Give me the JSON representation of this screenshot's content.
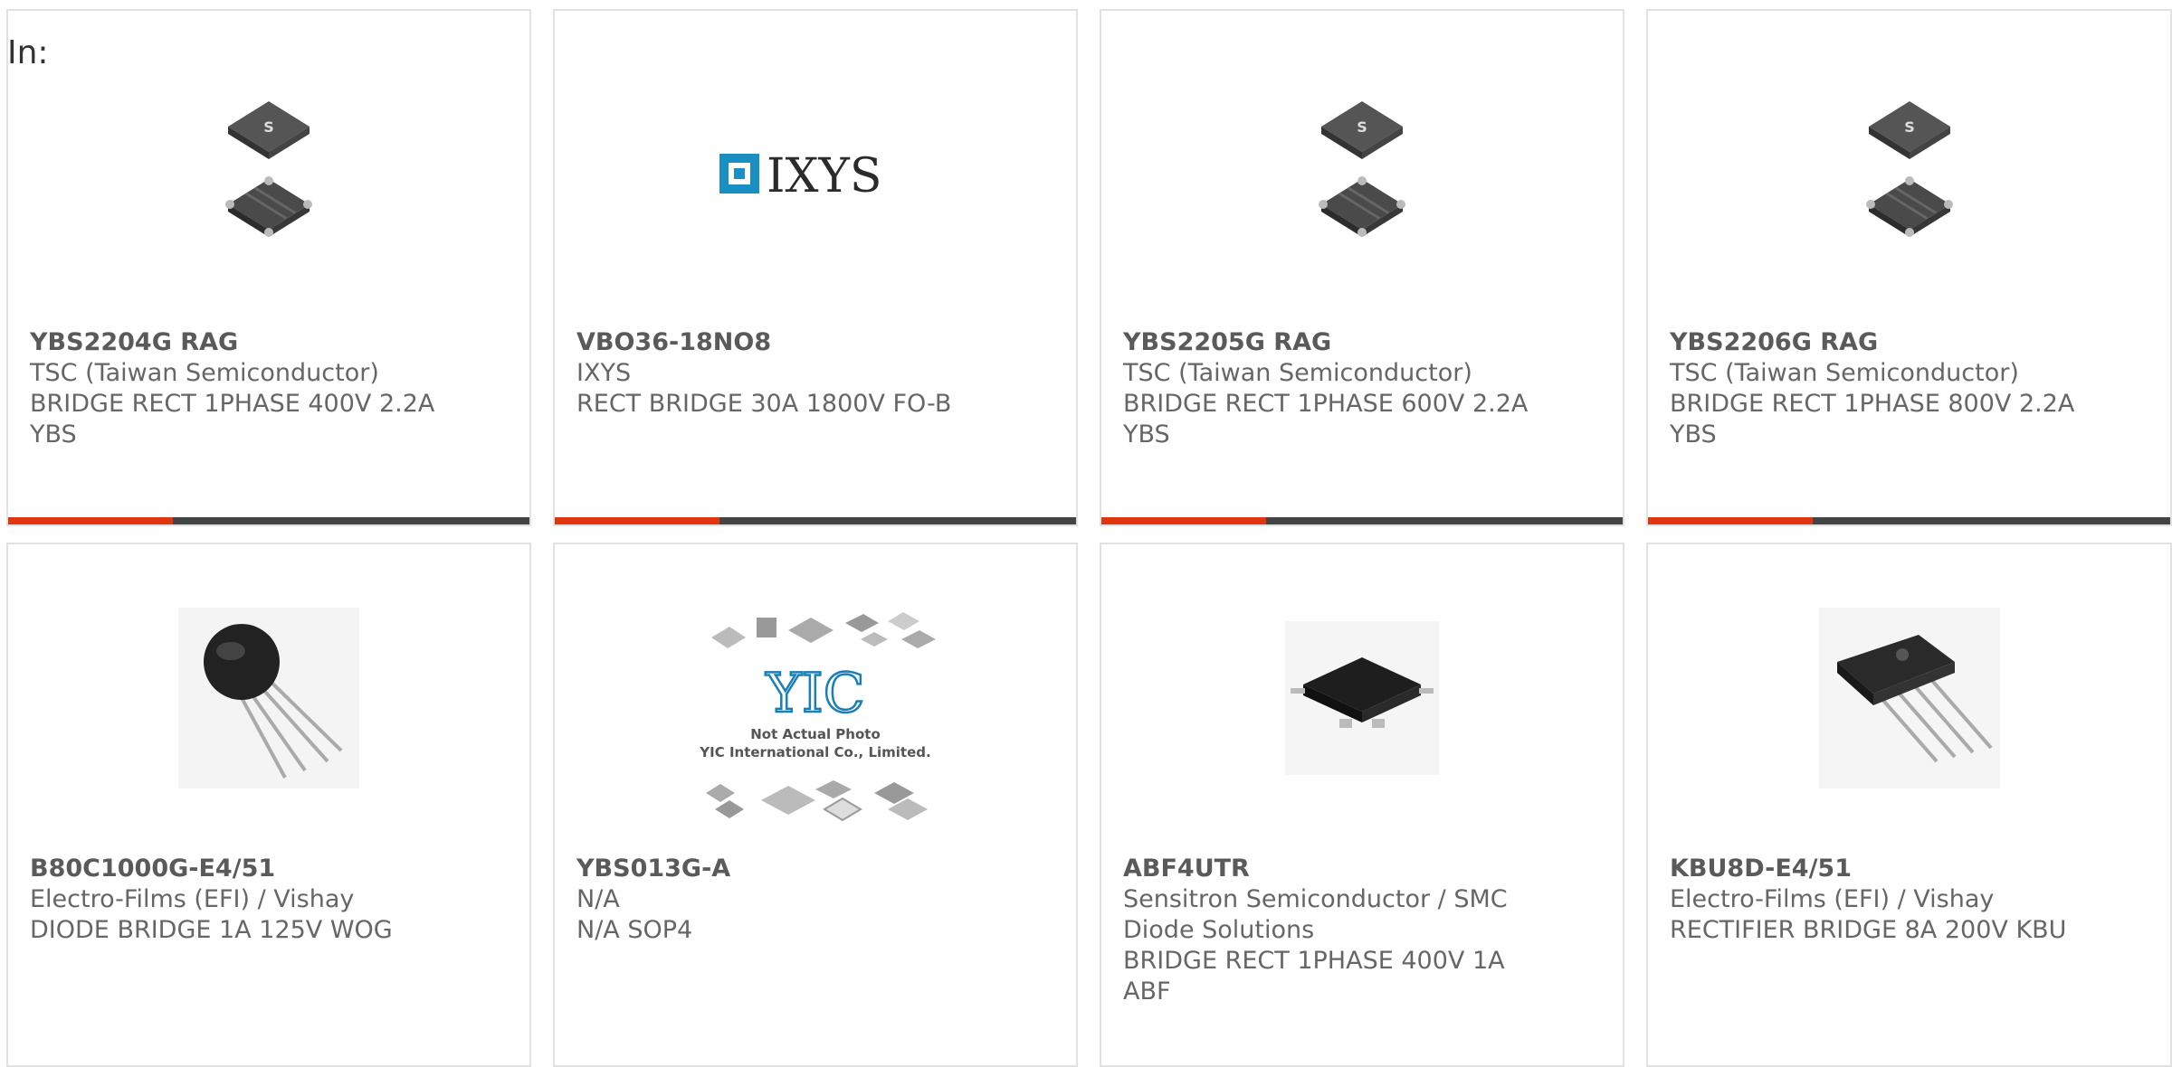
{
  "header": {
    "in_label": "In:"
  },
  "colors": {
    "accent": "#e0350f",
    "bar_dark": "#444444",
    "border": "#e2e2e2",
    "text": "#666666"
  },
  "products": [
    {
      "part_number": "YBS2204G RAG",
      "manufacturer": "TSC (Taiwan Semiconductor)",
      "desc1": "BRIDGE RECT 1PHASE 400V 2.2A",
      "desc2": "YBS",
      "image": "tsc-ybs-package"
    },
    {
      "part_number": "VBO36-18NO8",
      "manufacturer": "IXYS",
      "desc1": "RECT BRIDGE 30A 1800V FO-B",
      "desc2": "",
      "image": "ixys-logo",
      "logo_text": "IXYS"
    },
    {
      "part_number": "YBS2205G RAG",
      "manufacturer": "TSC (Taiwan Semiconductor)",
      "desc1": "BRIDGE RECT 1PHASE 600V 2.2A",
      "desc2": "YBS",
      "image": "tsc-ybs-package"
    },
    {
      "part_number": "YBS2206G RAG",
      "manufacturer": "TSC (Taiwan Semiconductor)",
      "desc1": "BRIDGE RECT 1PHASE 800V 2.2A",
      "desc2": "YBS",
      "image": "tsc-ybs-package"
    },
    {
      "part_number": "B80C1000G-E4/51",
      "manufacturer": "Electro-Films (EFI) / Vishay",
      "desc1": "DIODE BRIDGE 1A 125V WOG",
      "desc2": "",
      "image": "wog-round-package"
    },
    {
      "part_number": "YBS013G-A",
      "manufacturer": "N/A",
      "desc1": "N/A SOP4",
      "desc2": "",
      "image": "yic-placeholder",
      "placeholder_line1": "Not Actual Photo",
      "placeholder_line2": "YIC International Co., Limited."
    },
    {
      "part_number": "ABF4UTR",
      "manufacturer": "Sensitron Semiconductor / SMC",
      "manufacturer2": "Diode Solutions",
      "desc1": "BRIDGE RECT 1PHASE 400V 1A",
      "desc2": "ABF",
      "image": "abf-smd-package"
    },
    {
      "part_number": "KBU8D-E4/51",
      "manufacturer": "Electro-Films (EFI) / Vishay",
      "desc1": "RECTIFIER BRIDGE 8A 200V KBU",
      "desc2": "",
      "image": "kbu-package"
    }
  ]
}
